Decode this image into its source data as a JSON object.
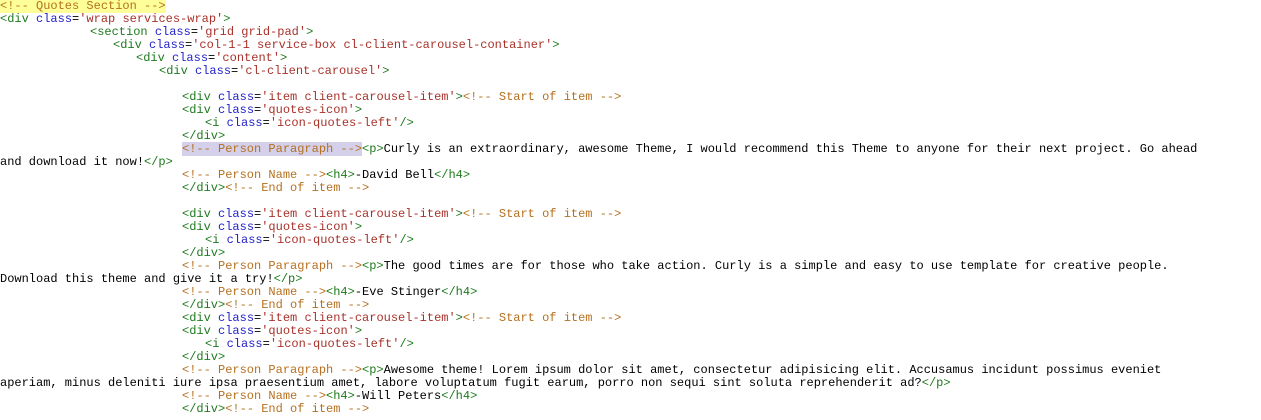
{
  "colors": {
    "tag": "#1d7a1d",
    "attribute": "#2323c8",
    "value": "#a8322a",
    "comment": "#b5701f",
    "text": "#000000",
    "highlight_yellow": "#ffff99",
    "highlight_selection": "#d4d0ea"
  },
  "lines": [
    {
      "indent": "i0",
      "tokens": [
        [
          "c hl-yellow",
          "<!-- Quotes Section -->"
        ]
      ]
    },
    {
      "indent": "i0",
      "tokens": [
        [
          "t",
          "<div "
        ],
        [
          "a",
          "class"
        ],
        [
          "x",
          "="
        ],
        [
          "v",
          "'wrap services-wrap'"
        ],
        [
          "t",
          ">"
        ]
      ]
    },
    {
      "indent": "i1",
      "tokens": [
        [
          "t",
          "<section "
        ],
        [
          "a",
          "class"
        ],
        [
          "x",
          "="
        ],
        [
          "v",
          "'grid grid-pad'"
        ],
        [
          "t",
          ">"
        ]
      ]
    },
    {
      "indent": "i2",
      "tokens": [
        [
          "t",
          "<div "
        ],
        [
          "a",
          "class"
        ],
        [
          "x",
          "="
        ],
        [
          "v",
          "'col-1-1 service-box cl-client-carousel-container'"
        ],
        [
          "t",
          ">"
        ]
      ]
    },
    {
      "indent": "i3",
      "tokens": [
        [
          "t",
          "<div "
        ],
        [
          "a",
          "class"
        ],
        [
          "x",
          "="
        ],
        [
          "v",
          "'content'"
        ],
        [
          "t",
          ">"
        ]
      ]
    },
    {
      "indent": "i4",
      "tokens": [
        [
          "t",
          "<div "
        ],
        [
          "a",
          "class"
        ],
        [
          "x",
          "="
        ],
        [
          "v",
          "'cl-client-carousel'"
        ],
        [
          "t",
          ">"
        ]
      ]
    },
    {
      "indent": "i0",
      "tokens": []
    },
    {
      "indent": "i5",
      "tokens": [
        [
          "t",
          "<div "
        ],
        [
          "a",
          "class"
        ],
        [
          "x",
          "="
        ],
        [
          "v",
          "'item client-carousel-item'"
        ],
        [
          "t",
          ">"
        ],
        [
          "c",
          "<!-- Start of item -->"
        ]
      ]
    },
    {
      "indent": "i5",
      "tokens": [
        [
          "t",
          "<div "
        ],
        [
          "a",
          "class"
        ],
        [
          "x",
          "="
        ],
        [
          "v",
          "'quotes-icon'"
        ],
        [
          "t",
          ">"
        ]
      ]
    },
    {
      "indent": "i6",
      "tokens": [
        [
          "t",
          "<i "
        ],
        [
          "a",
          "class"
        ],
        [
          "x",
          "="
        ],
        [
          "v",
          "'icon-quotes-left'"
        ],
        [
          "t",
          "/>"
        ]
      ]
    },
    {
      "indent": "i5",
      "tokens": [
        [
          "t",
          "</div>"
        ]
      ]
    },
    {
      "indent": "i5",
      "tokens": [
        [
          "c hl-lav",
          "<!-- Person Paragraph -->"
        ],
        [
          "t",
          "<p>"
        ],
        [
          "x",
          "Curly is an extraordinary, awesome Theme, I would recommend this Theme to anyone for their next project. Go ahead"
        ]
      ]
    },
    {
      "indent": "i0",
      "tokens": [
        [
          "x",
          "and download it now!"
        ],
        [
          "t",
          "</p>"
        ]
      ]
    },
    {
      "indent": "i5",
      "tokens": [
        [
          "c",
          "<!-- Person Name -->"
        ],
        [
          "t",
          "<h4>"
        ],
        [
          "x",
          "-David Bell"
        ],
        [
          "t",
          "</h4>"
        ]
      ]
    },
    {
      "indent": "i5",
      "tokens": [
        [
          "t",
          "</div>"
        ],
        [
          "c",
          "<!-- End of item -->"
        ]
      ]
    },
    {
      "indent": "i0",
      "tokens": []
    },
    {
      "indent": "i5",
      "tokens": [
        [
          "t",
          "<div "
        ],
        [
          "a",
          "class"
        ],
        [
          "x",
          "="
        ],
        [
          "v",
          "'item client-carousel-item'"
        ],
        [
          "t",
          ">"
        ],
        [
          "c",
          "<!-- Start of item -->"
        ]
      ]
    },
    {
      "indent": "i5",
      "tokens": [
        [
          "t",
          "<div "
        ],
        [
          "a",
          "class"
        ],
        [
          "x",
          "="
        ],
        [
          "v",
          "'quotes-icon'"
        ],
        [
          "t",
          ">"
        ]
      ]
    },
    {
      "indent": "i6",
      "tokens": [
        [
          "t",
          "<i "
        ],
        [
          "a",
          "class"
        ],
        [
          "x",
          "="
        ],
        [
          "v",
          "'icon-quotes-left'"
        ],
        [
          "t",
          "/>"
        ]
      ]
    },
    {
      "indent": "i5",
      "tokens": [
        [
          "t",
          "</div>"
        ]
      ]
    },
    {
      "indent": "i5",
      "tokens": [
        [
          "c",
          "<!-- Person Paragraph -->"
        ],
        [
          "t",
          "<p>"
        ],
        [
          "x",
          "The good times are for those who take action. Curly is a simple and easy to use template for creative people."
        ]
      ]
    },
    {
      "indent": "i0",
      "tokens": [
        [
          "x",
          "Download this theme and give it a try!"
        ],
        [
          "t",
          "</p>"
        ]
      ]
    },
    {
      "indent": "i5",
      "tokens": [
        [
          "c",
          "<!-- Person Name -->"
        ],
        [
          "t",
          "<h4>"
        ],
        [
          "x",
          "-Eve Stinger"
        ],
        [
          "t",
          "</h4>"
        ]
      ]
    },
    {
      "indent": "i5",
      "tokens": [
        [
          "t",
          "</div>"
        ],
        [
          "c",
          "<!-- End of item -->"
        ]
      ]
    },
    {
      "indent": "i5",
      "tokens": [
        [
          "t",
          "<div "
        ],
        [
          "a",
          "class"
        ],
        [
          "x",
          "="
        ],
        [
          "v",
          "'item client-carousel-item'"
        ],
        [
          "t",
          ">"
        ],
        [
          "c",
          "<!-- Start of item -->"
        ]
      ]
    },
    {
      "indent": "i5",
      "tokens": [
        [
          "t",
          "<div "
        ],
        [
          "a",
          "class"
        ],
        [
          "x",
          "="
        ],
        [
          "v",
          "'quotes-icon'"
        ],
        [
          "t",
          ">"
        ]
      ]
    },
    {
      "indent": "i6",
      "tokens": [
        [
          "t",
          "<i "
        ],
        [
          "a",
          "class"
        ],
        [
          "x",
          "="
        ],
        [
          "v",
          "'icon-quotes-left'"
        ],
        [
          "t",
          "/>"
        ]
      ]
    },
    {
      "indent": "i5",
      "tokens": [
        [
          "t",
          "</div>"
        ]
      ]
    },
    {
      "indent": "i5",
      "tokens": [
        [
          "c",
          "<!-- Person Paragraph -->"
        ],
        [
          "t",
          "<p>"
        ],
        [
          "x",
          "Awesome theme! Lorem ipsum dolor sit amet, consectetur adipisicing elit. Accusamus incidunt possimus eveniet"
        ]
      ]
    },
    {
      "indent": "i0",
      "tokens": [
        [
          "x",
          "aperiam, minus deleniti iure ipsa praesentium amet, labore voluptatum fugit earum, porro non sequi sint soluta reprehenderit ad?"
        ],
        [
          "t",
          "</p>"
        ]
      ]
    },
    {
      "indent": "i5",
      "tokens": [
        [
          "c",
          "<!-- Person Name -->"
        ],
        [
          "t",
          "<h4>"
        ],
        [
          "x",
          "-Will Peters"
        ],
        [
          "t",
          "</h4>"
        ]
      ]
    },
    {
      "indent": "i5",
      "tokens": [
        [
          "t",
          "</div>"
        ],
        [
          "c",
          "<!-- End of item -->"
        ]
      ]
    }
  ]
}
